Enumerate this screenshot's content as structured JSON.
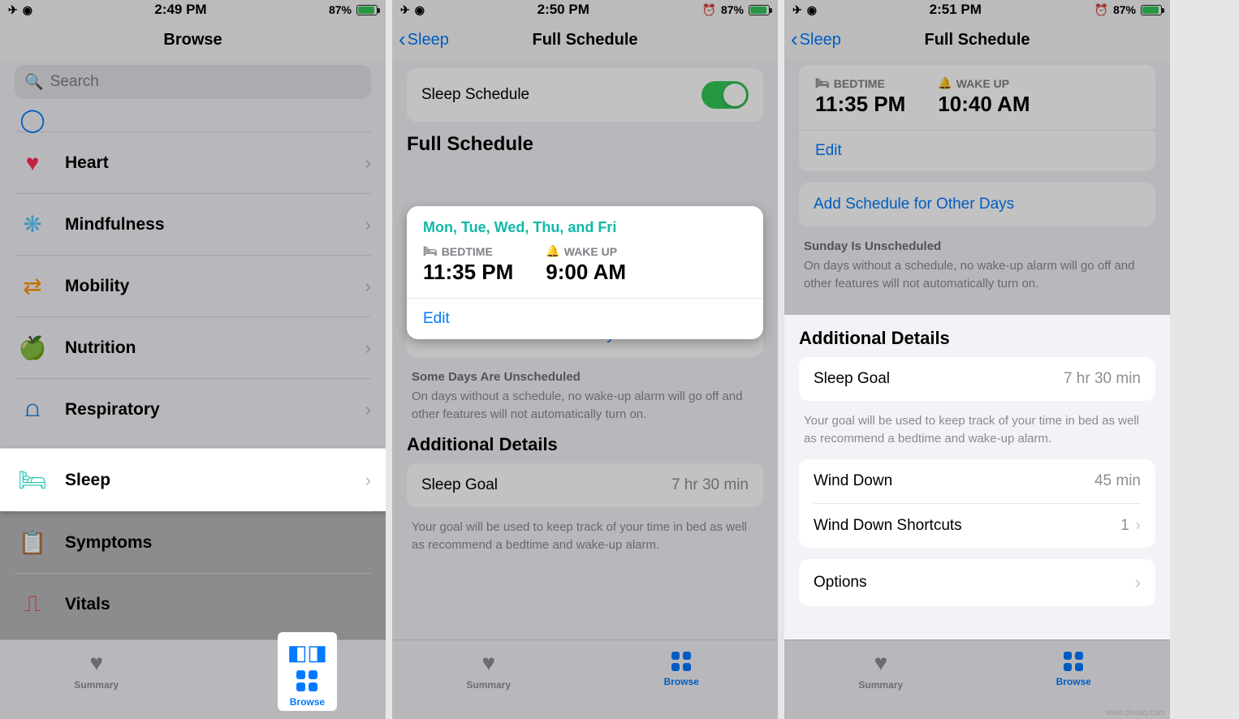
{
  "status": {
    "battery": "87%"
  },
  "screens": {
    "s1": {
      "time": "2:49 PM",
      "title": "Browse",
      "search_placeholder": "Search",
      "categories": [
        {
          "name": "Heart",
          "icon": "❤",
          "color": "#ff2d55"
        },
        {
          "name": "Mindfulness",
          "icon": "❋",
          "color": "#5ac8fa"
        },
        {
          "name": "Mobility",
          "icon": "⇄",
          "color": "#ff9500"
        },
        {
          "name": "Nutrition",
          "icon": "🍏",
          "color": "#34c759"
        },
        {
          "name": "Respiratory",
          "icon": "🫁",
          "color": "#2f8bd6"
        },
        {
          "name": "Sleep",
          "icon": "🛏",
          "color": "#23c3b0"
        },
        {
          "name": "Symptoms",
          "icon": "📋",
          "color": "#7d57c1"
        },
        {
          "name": "Vitals",
          "icon": "⎍",
          "color": "#ff3b30"
        }
      ],
      "tabs": {
        "summary": "Summary",
        "browse": "Browse"
      }
    },
    "s2": {
      "time": "2:50 PM",
      "back": "Sleep",
      "title": "Full Schedule",
      "toggle_label": "Sleep Schedule",
      "section_full": "Full Schedule",
      "days": "Mon, Tue, Wed, Thu, and Fri",
      "bedtime_label": "BEDTIME",
      "bedtime_val": "11:35 PM",
      "wakeup_label": "WAKE UP",
      "wakeup_val": "9:00 AM",
      "edit": "Edit",
      "add_schedule": "Add Schedule for Other Days",
      "unsched_title": "Some Days Are Unscheduled",
      "unsched_body": "On days without a schedule, no wake-up alarm will go off and other features will not automatically turn on.",
      "section_details": "Additional Details",
      "sleep_goal_label": "Sleep Goal",
      "sleep_goal_val": "7 hr 30 min",
      "goal_note": "Your goal will be used to keep track of your time in bed as well as recommend a bedtime and wake-up alarm."
    },
    "s3": {
      "time": "2:51 PM",
      "back": "Sleep",
      "title": "Full Schedule",
      "bedtime_label": "BEDTIME",
      "bedtime_val": "11:35 PM",
      "wakeup_label": "WAKE UP",
      "wakeup_val": "10:40 AM",
      "edit": "Edit",
      "add_schedule": "Add Schedule for Other Days",
      "unsched_title": "Sunday Is Unscheduled",
      "unsched_body": "On days without a schedule, no wake-up alarm will go off and other features will not automatically turn on.",
      "section_details": "Additional Details",
      "sleep_goal_label": "Sleep Goal",
      "sleep_goal_val": "7 hr 30 min",
      "goal_note": "Your goal will be used to keep track of your time in bed as well as recommend a bedtime and wake-up alarm.",
      "wind_down_label": "Wind Down",
      "wind_down_val": "45 min",
      "wd_shortcuts_label": "Wind Down Shortcuts",
      "wd_shortcuts_val": "1",
      "options": "Options"
    }
  },
  "watermark": "www.deuaq.com"
}
